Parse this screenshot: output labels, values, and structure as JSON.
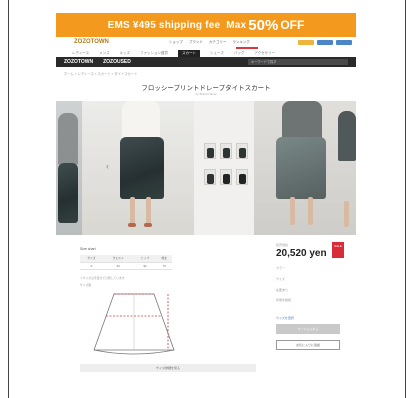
{
  "promo": {
    "text": "EMS ¥495 shipping fee",
    "max": "Max",
    "discount": "50%",
    "off": "OFF"
  },
  "header": {
    "logo": "ZOZOTOWN",
    "links": [
      "ショップ",
      "ブランド",
      "カテゴリー",
      "ランキング"
    ]
  },
  "nav": {
    "items": [
      "レディース",
      "メンズ",
      "キッズ",
      "ファッション雑貨",
      "スカート",
      "シューズ",
      "バッグ",
      "アクセサリー"
    ],
    "active_index": 4
  },
  "sitebar": {
    "items": [
      "ZOZOTOWN",
      "ZOZOUSED"
    ],
    "search_placeholder": "キーワードで探す"
  },
  "breadcrumb": "ホーム > レディース > スカート > タイトスカート",
  "product": {
    "title": "フロッシープリントドレープタイトスカート",
    "brand": "by Brand Name",
    "price_label": "販売価格",
    "price": "20,520 yen",
    "badge": "SALE",
    "info": [
      "カラー",
      "サイズ",
      "在庫あり",
      "状態を確認"
    ],
    "size_select": "サイズを選択",
    "add_to_cart": "カートに入れる",
    "favorite": "お気に入りに追加"
  },
  "size": {
    "title": "Size chart",
    "headers": [
      "サイズ",
      "ウエスト",
      "ヒップ",
      "総丈"
    ],
    "row": [
      "S",
      "64",
      "92",
      "70"
    ],
    "note": "※サイズは平置きで計測しています",
    "diagram_label": "サイズ図",
    "more_button": "サイズ詳細を見る"
  },
  "colors": {
    "promo": "#f39a1e",
    "dark": "#2a2a2a",
    "badge": "#d82c3a"
  }
}
